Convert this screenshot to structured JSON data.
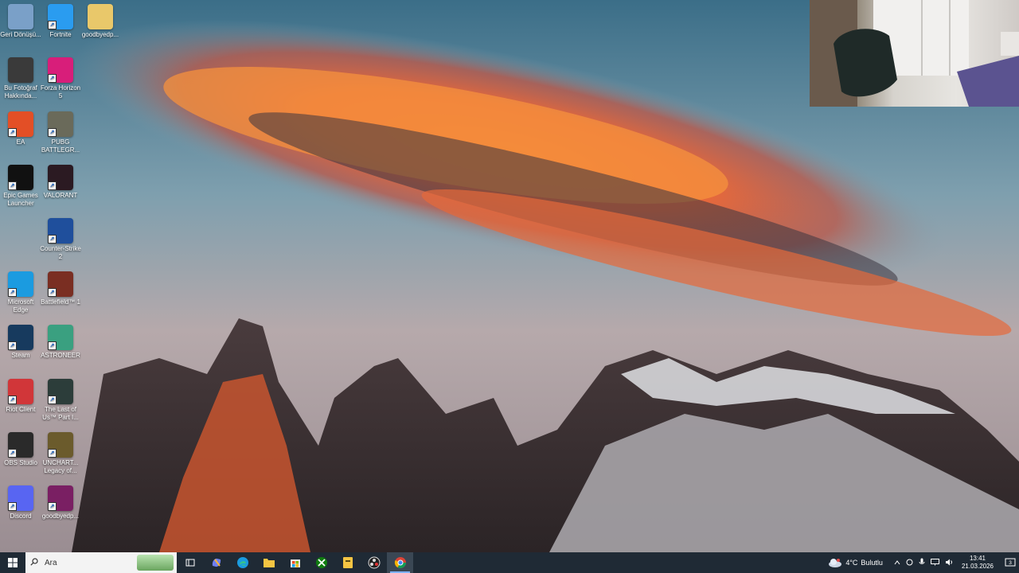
{
  "desktop_icons": [
    {
      "label": "Geri Dönüşü...",
      "icon": "recycle-bin-icon",
      "color": "#7aa0c8"
    },
    {
      "label": "Fortnite",
      "icon": "fortnite-icon",
      "color": "#2a9cf0"
    },
    {
      "label": "goodbyedp...",
      "icon": "folder-icon",
      "color": "#e9c86a"
    },
    {
      "label": "Bu Fotoğraf Hakkında...",
      "icon": "info-icon",
      "color": "#3a3a3a"
    },
    {
      "label": "Forza Horizon 5",
      "icon": "forza-icon",
      "color": "#d81e7a"
    },
    {
      "label": "EA",
      "icon": "ea-icon",
      "color": "#e34f26"
    },
    {
      "label": "PUBG BATTLEGR...",
      "icon": "pubg-icon",
      "color": "#6a6a5a"
    },
    {
      "label": "Epic Games Launcher",
      "icon": "epic-games-icon",
      "color": "#111111"
    },
    {
      "label": "VALORANT",
      "icon": "valorant-icon",
      "color": "#2b1a22"
    },
    {
      "label": "Counter-Strike 2",
      "icon": "counter-strike-icon",
      "color": "#1f4f9c"
    },
    {
      "label": "Microsoft Edge",
      "icon": "edge-icon",
      "color": "#1b9be0"
    },
    {
      "label": "Battlefield™ 1",
      "icon": "battlefield-icon",
      "color": "#7a2e22"
    },
    {
      "label": "Steam",
      "icon": "steam-icon",
      "color": "#173a5e"
    },
    {
      "label": "ASTRONEER",
      "icon": "astroneer-icon",
      "color": "#3aa080"
    },
    {
      "label": "Riot Client",
      "icon": "riot-client-icon",
      "color": "#d13639"
    },
    {
      "label": "The Last of Us™ Part I...",
      "icon": "last-of-us-icon",
      "color": "#2c3d3a"
    },
    {
      "label": "OBS Studio",
      "icon": "obs-icon",
      "color": "#2a2a2a"
    },
    {
      "label": "UNCHART... Legacy of...",
      "icon": "uncharted-icon",
      "color": "#6b5b2c"
    },
    {
      "label": "Discord",
      "icon": "discord-icon",
      "color": "#5865f2"
    },
    {
      "label": "goodbyedp...",
      "icon": "winrar-icon",
      "color": "#7a1f63"
    }
  ],
  "taskbar": {
    "search_placeholder": "Ara",
    "apps": [
      {
        "name": "task-view",
        "icon": "task-view-icon"
      },
      {
        "name": "copilot",
        "icon": "copilot-icon"
      },
      {
        "name": "edge",
        "icon": "edge-icon"
      },
      {
        "name": "file-explorer",
        "icon": "folder-icon"
      },
      {
        "name": "store",
        "icon": "store-icon"
      },
      {
        "name": "xbox",
        "icon": "xbox-icon"
      },
      {
        "name": "file-app",
        "icon": "file-icon"
      },
      {
        "name": "obs",
        "icon": "obs-icon"
      },
      {
        "name": "chrome",
        "icon": "chrome-icon",
        "active": true
      }
    ],
    "weather": {
      "temp": "4°C",
      "condition": "Bulutlu"
    },
    "clock": {
      "time": "13:41",
      "date": "21.03.2026"
    },
    "notification_count": "3"
  },
  "colors": {
    "taskbar": "#1f2a35",
    "accent": "#7fb3ff"
  }
}
